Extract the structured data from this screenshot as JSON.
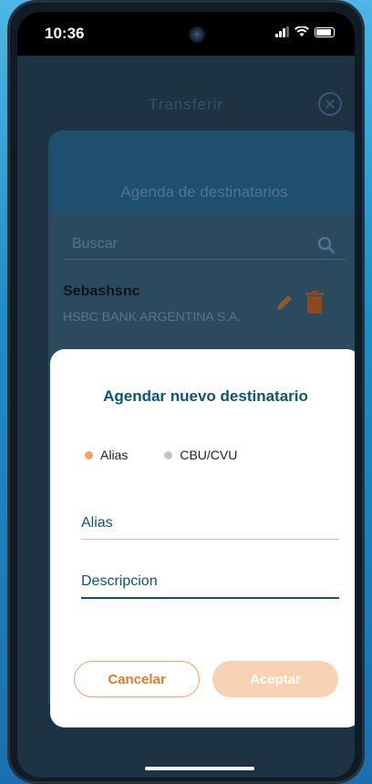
{
  "status_bar": {
    "time": "10:36"
  },
  "header": {
    "title": "Transferir"
  },
  "agenda": {
    "title": "Agenda de destinatarios",
    "search_placeholder": "Buscar",
    "contact": {
      "name": "Sebashsnc",
      "bank": "HSBC BANK ARGENTINA S.A."
    }
  },
  "modal": {
    "title": "Agendar nuevo destinatario",
    "radio_options": [
      {
        "label": "Alias",
        "selected": true
      },
      {
        "label": "CBU/CVU",
        "selected": false
      }
    ],
    "alias_placeholder": "Alias",
    "description_placeholder": "Descripcion",
    "cancel_label": "Cancelar",
    "accept_label": "Aceptar"
  },
  "colors": {
    "accent": "#f5a263",
    "primary": "#0f5471",
    "disabled_button": "#f9d1b3"
  }
}
